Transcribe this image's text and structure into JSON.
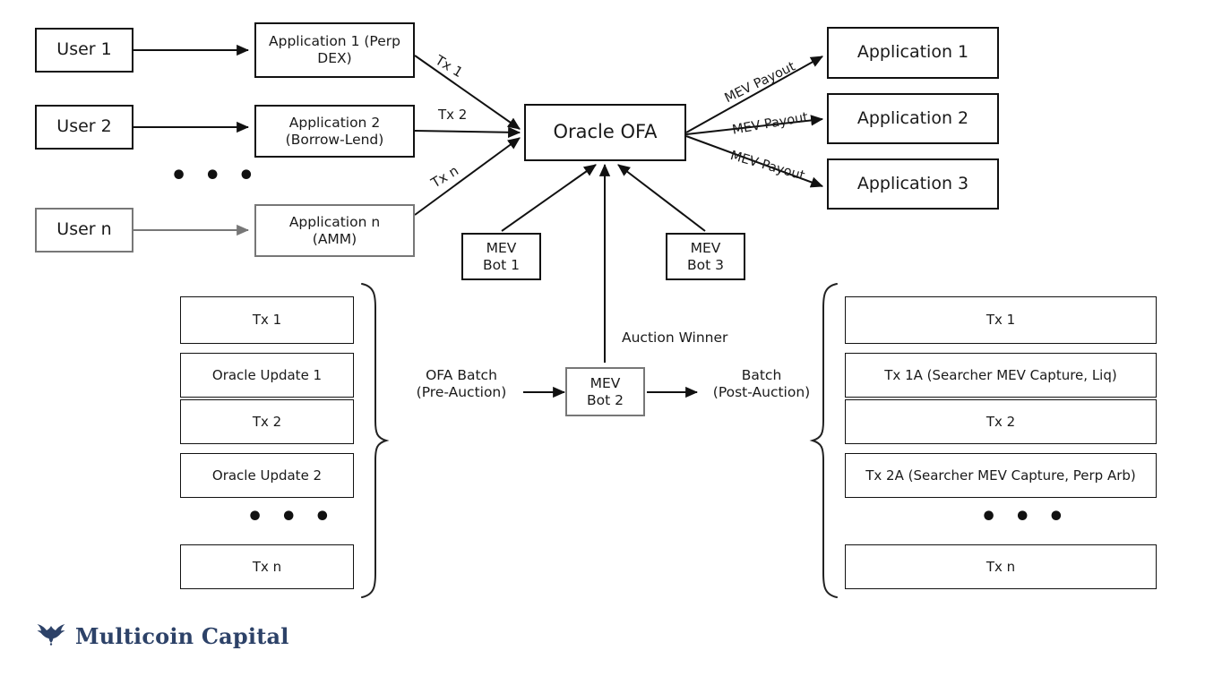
{
  "diagram": {
    "title": "Oracle OFA (Oracle Order Flow Auction) architecture diagram",
    "colors": {
      "stroke": "#111111",
      "stroke_muted": "#777777",
      "background": "#ffffff",
      "text": "#1a1a1a",
      "brand_navy": "#2d4268"
    },
    "users": [
      {
        "label": "User 1",
        "muted": false
      },
      {
        "label": "User 2",
        "muted": false
      },
      {
        "label": "User n",
        "muted": true
      }
    ],
    "source_applications": [
      {
        "label": "Application 1 (Perp\nDEX)",
        "muted": false
      },
      {
        "label": "Application 2\n(Borrow-Lend)",
        "muted": false
      },
      {
        "label": "Application n\n(AMM)",
        "muted": true
      }
    ],
    "tx_edge_labels": [
      "Tx 1",
      "Tx 2",
      "Tx n"
    ],
    "hub": {
      "label": "Oracle OFA"
    },
    "payout_edge_labels": [
      "MEV Payout",
      "MEV Payout",
      "MEV Payout"
    ],
    "target_applications": [
      {
        "label": "Application 1"
      },
      {
        "label": "Application 2"
      },
      {
        "label": "Application 3"
      }
    ],
    "mev_bots": [
      {
        "label": "MEV\nBot 1",
        "muted": false
      },
      {
        "label": "MEV\nBot 3",
        "muted": false
      },
      {
        "label": "MEV\nBot 2",
        "muted": true
      }
    ],
    "auction_winner_label": "Auction Winner",
    "ellipsis_glyph": "• • •",
    "users_ellipsis": "• • •",
    "pre_auction": {
      "caption": "OFA Batch\n(Pre-Auction)",
      "items": [
        {
          "label": "Tx 1",
          "group": "single"
        },
        {
          "label": "Oracle Update 1",
          "group": "pair-top"
        },
        {
          "label": "Tx 2",
          "group": "pair-bottom"
        },
        {
          "label": "Oracle Update 2",
          "group": "single"
        },
        {
          "label": "Tx n",
          "group": "single"
        }
      ],
      "ellipsis": "• • •"
    },
    "post_auction": {
      "caption": "Batch\n(Post-Auction)",
      "items": [
        {
          "label": "Tx 1",
          "group": "single"
        },
        {
          "label": "Tx 1A (Searcher MEV Capture, Liq)",
          "group": "pair-top"
        },
        {
          "label": "Tx 2",
          "group": "pair-bottom"
        },
        {
          "label": "Tx 2A (Searcher MEV Capture, Perp Arb)",
          "group": "single"
        },
        {
          "label": "Tx n",
          "group": "single"
        }
      ],
      "ellipsis": "• • •"
    }
  },
  "footer": {
    "brand_name": "Multicoin Capital",
    "logo_icon": "eagle-icon"
  }
}
